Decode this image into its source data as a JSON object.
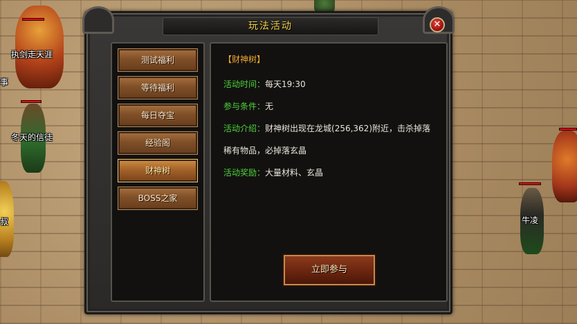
{
  "background_npcs": [
    {
      "name": "执剑走天涯"
    },
    {
      "name": "事"
    },
    {
      "name": "冬天的信徒"
    },
    {
      "name": "叔"
    },
    {
      "name": "牛凌"
    }
  ],
  "dialog": {
    "title": "玩法活动",
    "close_glyph": "✕",
    "menu": [
      {
        "label": "测试福利",
        "active": false
      },
      {
        "label": "等待福利",
        "active": false
      },
      {
        "label": "每日夺宝",
        "active": false
      },
      {
        "label": "经验阁",
        "active": false
      },
      {
        "label": "财神树",
        "active": true
      },
      {
        "label": "BOSS之家",
        "active": false
      }
    ],
    "detail": {
      "title": "【财神树】",
      "time_label": "活动时间：",
      "time_value": "每天19:30",
      "condition_label": "参与条件：",
      "condition_value": "无",
      "intro_label": "活动介绍：",
      "intro_value": "财神树出现在龙城(256,362)附近，击杀掉落",
      "intro_value_cont": "稀有物品，必掉落玄晶",
      "reward_label": "活动奖励：",
      "reward_value": "大量材料、玄晶",
      "join_button": "立即参与"
    }
  },
  "colors": {
    "title_gold": "#f2d24a",
    "label_green": "#4fd13a",
    "event_title_orange": "#f0a92f",
    "hp_red": "#d8141a"
  }
}
